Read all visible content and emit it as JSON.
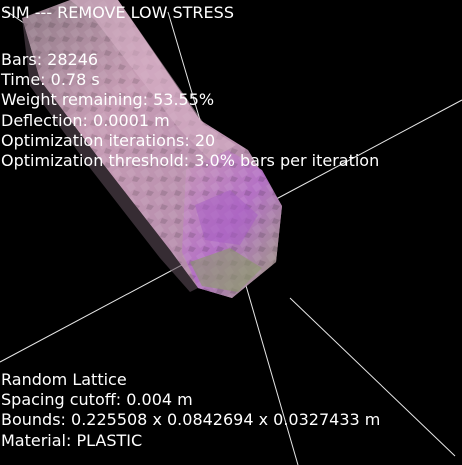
{
  "title": "SIM --- REMOVE LOW STRESS",
  "stats": {
    "bars": "Bars: 28246",
    "time": "Time: 0.78 s",
    "weight_remaining": "Weight remaining: 53.55%",
    "deflection": "Deflection: 0.0001 m",
    "optimization_iterations": "Optimization iterations: 20",
    "optimization_threshold": "Optimization threshold: 3.0% bars per iteration"
  },
  "lattice": {
    "type": "Random Lattice",
    "spacing_cutoff": "Spacing cutoff: 0.004 m",
    "bounds": "Bounds: 0.225508 x 0.0842694 x 0.0327433 m",
    "material": "Material: PLASTIC"
  },
  "colors": {
    "background": "#000000",
    "text": "#ffffff",
    "mesh_pink": "#c99ab4",
    "mesh_violet": "#a85fc2",
    "mesh_green": "#8a9a6a",
    "axis_line": "#ffffff"
  }
}
